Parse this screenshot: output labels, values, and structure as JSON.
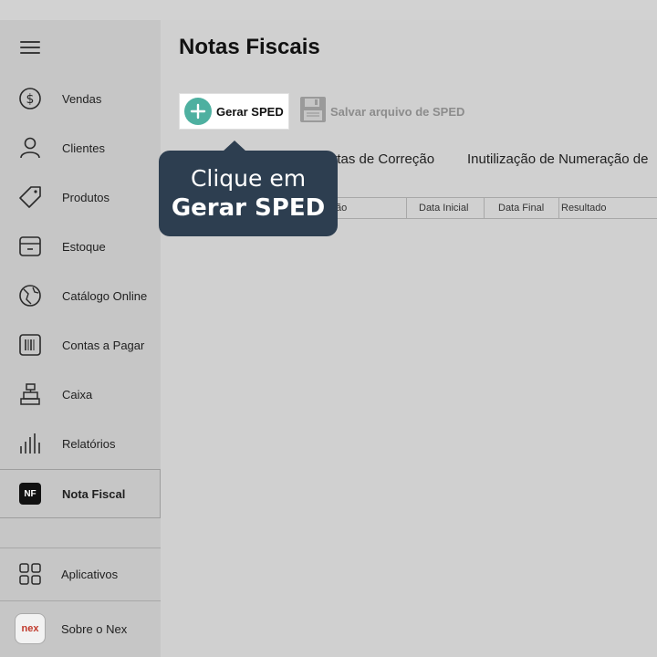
{
  "page": {
    "title": "Notas Fiscais"
  },
  "sidebar": {
    "items": [
      {
        "label": "Vendas",
        "icon": "dollar-circle-icon"
      },
      {
        "label": "Clientes",
        "icon": "person-icon"
      },
      {
        "label": "Produtos",
        "icon": "tag-icon"
      },
      {
        "label": "Estoque",
        "icon": "box-icon"
      },
      {
        "label": "Catálogo Online",
        "icon": "globe-icon"
      },
      {
        "label": "Contas a Pagar",
        "icon": "barcode-icon"
      },
      {
        "label": "Caixa",
        "icon": "cash-register-icon"
      },
      {
        "label": "Relatórios",
        "icon": "bar-chart-icon"
      },
      {
        "label": "Nota Fiscal",
        "icon": "nf-badge-icon",
        "badge": "NF",
        "active": true
      }
    ],
    "bottom": [
      {
        "label": "Aplicativos",
        "icon": "grid-icon"
      },
      {
        "label": "Sobre o Nex",
        "icon": "nex-logo-icon",
        "logo": "nex"
      }
    ]
  },
  "toolbar": {
    "gerar_label": "Gerar SPED",
    "salvar_label": "Salvar arquivo de SPED"
  },
  "tabs": [
    {
      "label": "artas de Correção"
    },
    {
      "label": "Inutilização de Numeração de"
    }
  ],
  "table": {
    "columns": [
      "ão",
      "Data Inicial",
      "Data Final",
      "Resultado"
    ]
  },
  "tooltip": {
    "line1": "Clique em",
    "line2": "Gerar SPED"
  },
  "colors": {
    "accent": "#4eb0a0",
    "tooltip_bg": "#2d3e50",
    "disabled_text": "#8c8c8c"
  }
}
